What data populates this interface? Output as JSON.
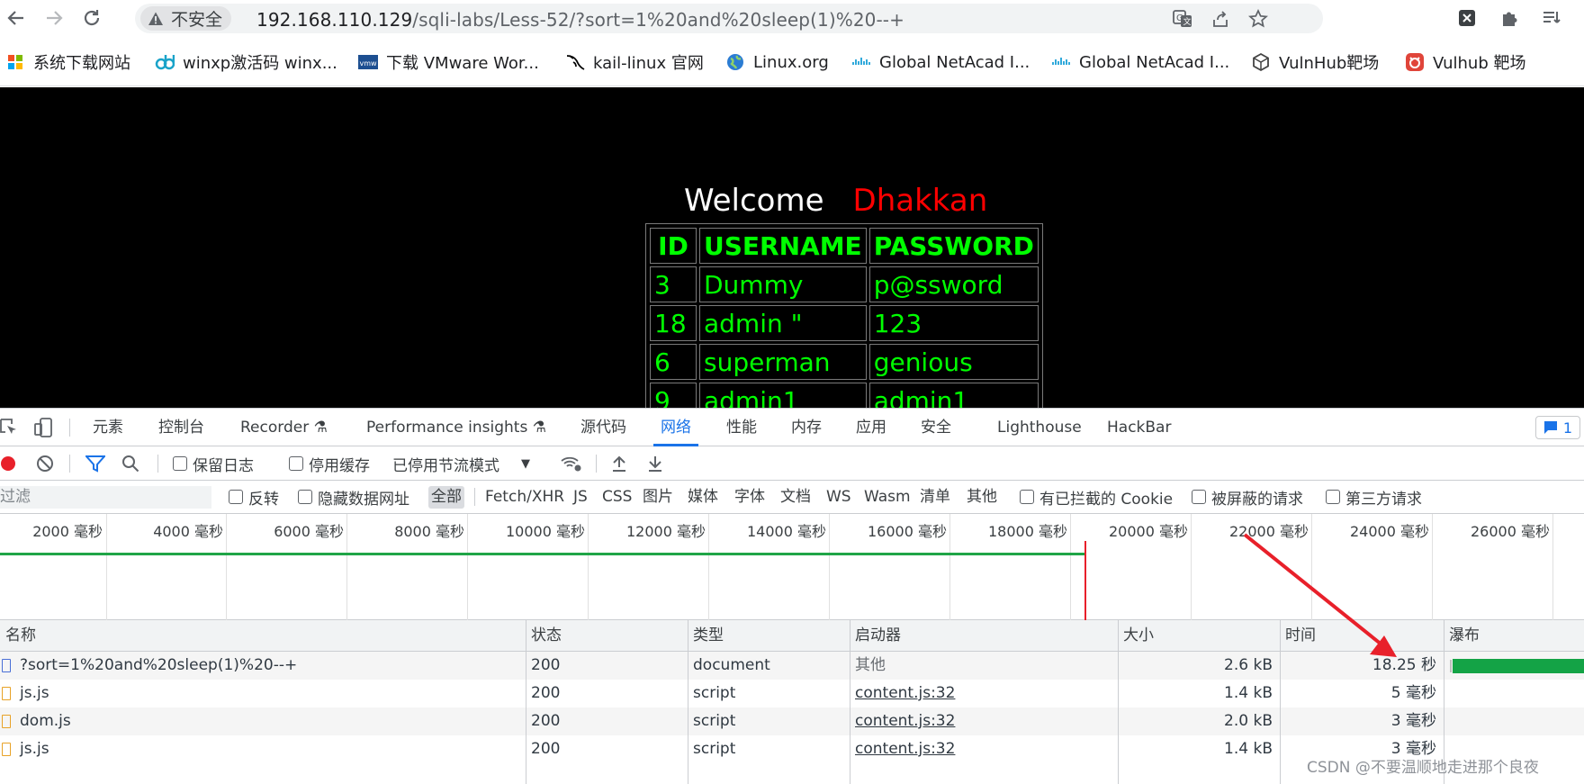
{
  "browser": {
    "security_label": "不安全",
    "url_host": "192.168.110.129",
    "url_rest": "/sqli-labs/Less-52/?sort=1%20and%20sleep(1)%20--+",
    "icons": [
      "back-icon",
      "forward-icon",
      "reload-icon",
      "warning-icon",
      "translate-icon",
      "share-icon",
      "star-icon",
      "extension-x-icon",
      "puzzle-icon",
      "reading-list-icon"
    ]
  },
  "bookmarks": [
    {
      "label": "系统下载网站",
      "icon": "windows-icon",
      "color": "#2f7de1"
    },
    {
      "label": "winxp激活码 winx...",
      "icon": "dd-icon",
      "color": "#1aa3c9"
    },
    {
      "label": "下载 VMware Wor...",
      "icon": "vmw-icon",
      "color": "#1d4f91"
    },
    {
      "label": "kail-linux 官网",
      "icon": "kali-dragon-icon",
      "color": "#000000"
    },
    {
      "label": "Linux.org",
      "icon": "globe-icon",
      "color": "#2b7cd3"
    },
    {
      "label": "Global NetAcad I...",
      "icon": "cisco-icon",
      "color": "#1ba0d7"
    },
    {
      "label": "Global NetAcad I...",
      "icon": "cisco-icon",
      "color": "#1ba0d7"
    },
    {
      "label": "VulnHub靶场",
      "icon": "vulnhub-icon",
      "color": "#444444"
    },
    {
      "label": "Vulhub 靶场",
      "icon": "vulhub-icon",
      "color": "#e0453a"
    }
  ],
  "page": {
    "welcome_text": "Welcome",
    "welcome_name": "Dhakkan",
    "table_headers": [
      "ID",
      "USERNAME",
      "PASSWORD"
    ],
    "rows": [
      [
        "3",
        "Dummy",
        "p@ssword"
      ],
      [
        "18",
        "admin \"",
        "123"
      ],
      [
        "6",
        "superman",
        "genious"
      ],
      [
        "9",
        "admin1",
        "admin1"
      ]
    ]
  },
  "devtools": {
    "tabs": [
      "元素",
      "控制台",
      "Recorder",
      "Performance insights",
      "源代码",
      "网络",
      "性能",
      "内存",
      "应用",
      "安全",
      "Lighthouse",
      "HackBar"
    ],
    "active_tab": "网络",
    "issues_count": "1",
    "toolbar": {
      "preserve_log": "保留日志",
      "disable_cache": "停用缓存",
      "throttling": "已停用节流模式"
    },
    "filter": {
      "placeholder": "过滤",
      "invert": "反转",
      "hide_data_urls": "隐藏数据网址",
      "types": [
        "全部",
        "Fetch/XHR",
        "JS",
        "CSS",
        "图片",
        "媒体",
        "字体",
        "文档",
        "WS",
        "Wasm",
        "清单",
        "其他"
      ],
      "active_type": "全部",
      "blocked_cookies": "有已拦截的 Cookie",
      "blocked_requests": "被屏蔽的请求",
      "third_party": "第三方请求"
    },
    "timeline_ticks": [
      "2000 毫秒",
      "4000 毫秒",
      "6000 毫秒",
      "8000 毫秒",
      "10000 毫秒",
      "12000 毫秒",
      "14000 毫秒",
      "16000 毫秒",
      "18000 毫秒",
      "20000 毫秒",
      "22000 毫秒",
      "24000 毫秒",
      "26000 毫秒"
    ],
    "columns": [
      "名称",
      "状态",
      "类型",
      "启动器",
      "大小",
      "时间",
      "瀑布"
    ],
    "requests": [
      {
        "name": "?sort=1%20and%20sleep(1)%20--+",
        "status": "200",
        "type": "document",
        "initiator": "其他",
        "size": "2.6 kB",
        "time": "18.25 秒",
        "kind": "doc"
      },
      {
        "name": "js.js",
        "status": "200",
        "type": "script",
        "initiator": "content.js:32",
        "size": "1.4 kB",
        "time": "5 毫秒",
        "kind": "js"
      },
      {
        "name": "dom.js",
        "status": "200",
        "type": "script",
        "initiator": "content.js:32",
        "size": "2.0 kB",
        "time": "3 毫秒",
        "kind": "js"
      },
      {
        "name": "js.js",
        "status": "200",
        "type": "script",
        "initiator": "content.js:32",
        "size": "1.4 kB",
        "time": "3 毫秒",
        "kind": "js"
      }
    ]
  },
  "watermark": "CSDN @不要温顺地走进那个良夜",
  "colors": {
    "accent": "#1a73e8",
    "annotation_arrow": "#e8202a",
    "load_bar": "#20a547",
    "sql_text": "#00ff00",
    "welcome_name": "#ff0000"
  }
}
